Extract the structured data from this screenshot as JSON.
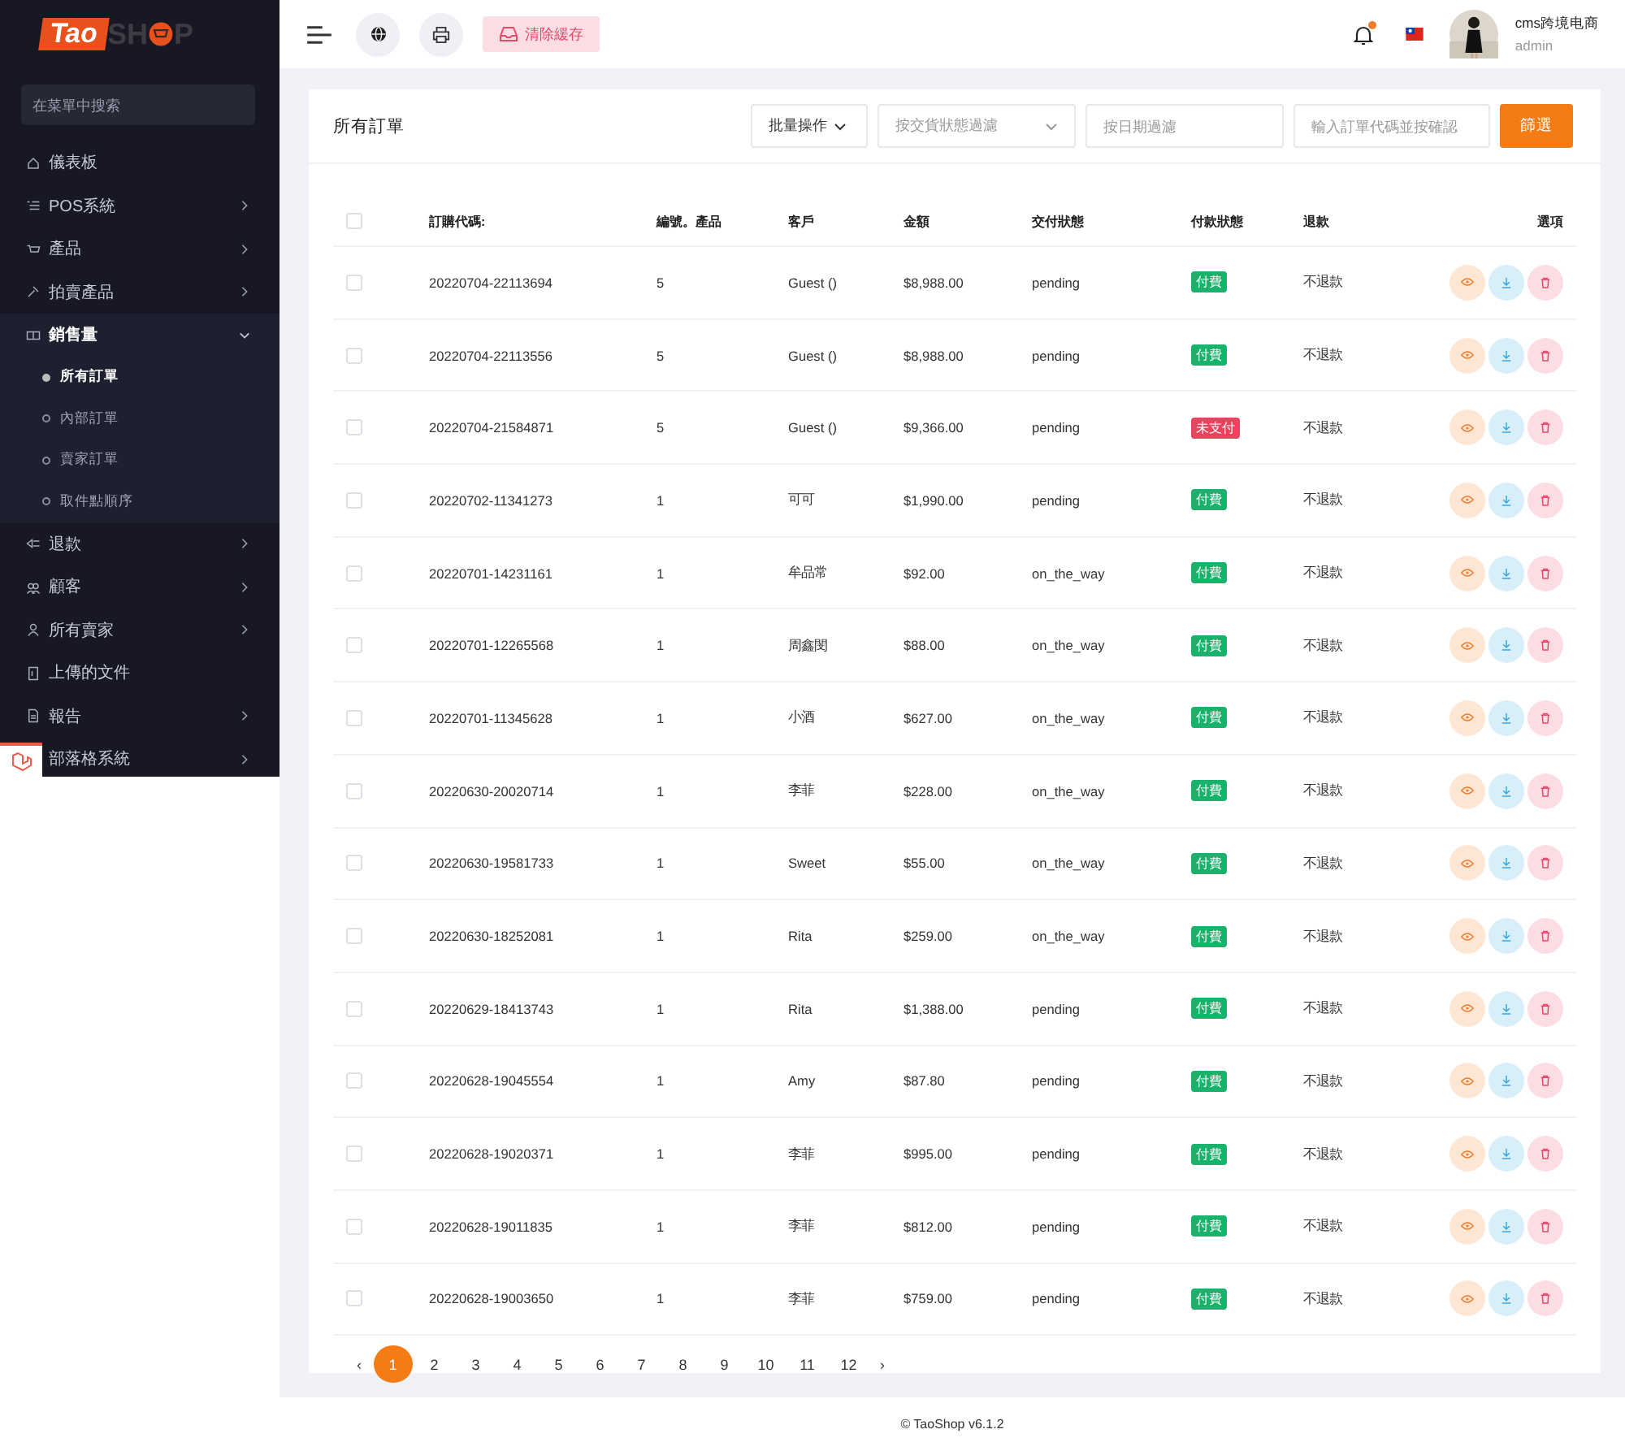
{
  "brand": {
    "prefix": "Tao",
    "word_start": "SH",
    "word_end": "P"
  },
  "sidebar": {
    "search": {
      "placeholder": "在菜單中搜索"
    },
    "items": [
      {
        "label": "儀表板",
        "has_arrow": false,
        "expanded": false
      },
      {
        "label": "POS系統",
        "has_arrow": true,
        "expanded": false
      },
      {
        "label": "產品",
        "has_arrow": true,
        "expanded": false
      },
      {
        "label": "拍賣產品",
        "has_arrow": true,
        "expanded": false
      },
      {
        "label": "銷售量",
        "has_arrow": true,
        "expanded": true,
        "children": [
          {
            "label": "所有訂單",
            "selected": true
          },
          {
            "label": "內部訂單",
            "selected": false
          },
          {
            "label": "賣家訂單",
            "selected": false
          },
          {
            "label": "取件點順序",
            "selected": false
          }
        ]
      },
      {
        "label": "退款",
        "has_arrow": true,
        "expanded": false
      },
      {
        "label": "顧客",
        "has_arrow": true,
        "expanded": false
      },
      {
        "label": "所有賣家",
        "has_arrow": true,
        "expanded": false
      },
      {
        "label": "上傳的文件",
        "has_arrow": false,
        "expanded": false
      },
      {
        "label": "報告",
        "has_arrow": true,
        "expanded": false
      },
      {
        "label": "部落格系統",
        "has_arrow": true,
        "expanded": false
      }
    ]
  },
  "topbar": {
    "clear_cache": "清除緩存",
    "notification": true,
    "user": {
      "name": "cms跨境电商",
      "role": "admin"
    }
  },
  "card": {
    "title": "所有訂單",
    "filters": {
      "bulk": "批量操作",
      "delivery_placeholder": "按交貨狀態過濾",
      "date_placeholder": "按日期過濾",
      "search_placeholder": "輸入訂單代碼並按確認",
      "button": "篩選"
    },
    "table": {
      "select_all_checked": false,
      "columns": [
        "訂購代碼:",
        "編號。產品",
        "客戶",
        "金額",
        "交付狀態",
        "付款狀態",
        "退款",
        "選項"
      ],
      "rows": [
        {
          "code": "20220704-22113694",
          "count": "5",
          "customer": "Guest ()",
          "amount": "$8,988.00",
          "delivery": "pending",
          "payment": "付費",
          "paid": true,
          "refund": "不退款",
          "checked": false
        },
        {
          "code": "20220704-22113556",
          "count": "5",
          "customer": "Guest ()",
          "amount": "$8,988.00",
          "delivery": "pending",
          "payment": "付費",
          "paid": true,
          "refund": "不退款",
          "checked": false
        },
        {
          "code": "20220704-21584871",
          "count": "5",
          "customer": "Guest ()",
          "amount": "$9,366.00",
          "delivery": "pending",
          "payment": "未支付",
          "paid": false,
          "refund": "不退款",
          "checked": false
        },
        {
          "code": "20220702-11341273",
          "count": "1",
          "customer": "可可",
          "amount": "$1,990.00",
          "delivery": "pending",
          "payment": "付費",
          "paid": true,
          "refund": "不退款",
          "checked": false
        },
        {
          "code": "20220701-14231161",
          "count": "1",
          "customer": "牟品常",
          "amount": "$92.00",
          "delivery": "on_the_way",
          "payment": "付費",
          "paid": true,
          "refund": "不退款",
          "checked": false
        },
        {
          "code": "20220701-12265568",
          "count": "1",
          "customer": "周鑫閔",
          "amount": "$88.00",
          "delivery": "on_the_way",
          "payment": "付費",
          "paid": true,
          "refund": "不退款",
          "checked": false
        },
        {
          "code": "20220701-11345628",
          "count": "1",
          "customer": "小酒",
          "amount": "$627.00",
          "delivery": "on_the_way",
          "payment": "付費",
          "paid": true,
          "refund": "不退款",
          "checked": false
        },
        {
          "code": "20220630-20020714",
          "count": "1",
          "customer": "李菲",
          "amount": "$228.00",
          "delivery": "on_the_way",
          "payment": "付費",
          "paid": true,
          "refund": "不退款",
          "checked": false
        },
        {
          "code": "20220630-19581733",
          "count": "1",
          "customer": "Sweet",
          "amount": "$55.00",
          "delivery": "on_the_way",
          "payment": "付費",
          "paid": true,
          "refund": "不退款",
          "checked": false
        },
        {
          "code": "20220630-18252081",
          "count": "1",
          "customer": "Rita",
          "amount": "$259.00",
          "delivery": "on_the_way",
          "payment": "付費",
          "paid": true,
          "refund": "不退款",
          "checked": false
        },
        {
          "code": "20220629-18413743",
          "count": "1",
          "customer": "Rita",
          "amount": "$1,388.00",
          "delivery": "pending",
          "payment": "付費",
          "paid": true,
          "refund": "不退款",
          "checked": false
        },
        {
          "code": "20220628-19045554",
          "count": "1",
          "customer": "Amy",
          "amount": "$87.80",
          "delivery": "pending",
          "payment": "付費",
          "paid": true,
          "refund": "不退款",
          "checked": false
        },
        {
          "code": "20220628-19020371",
          "count": "1",
          "customer": "李菲",
          "amount": "$995.00",
          "delivery": "pending",
          "payment": "付費",
          "paid": true,
          "refund": "不退款",
          "checked": false
        },
        {
          "code": "20220628-19011835",
          "count": "1",
          "customer": "李菲",
          "amount": "$812.00",
          "delivery": "pending",
          "payment": "付費",
          "paid": true,
          "refund": "不退款",
          "checked": false
        },
        {
          "code": "20220628-19003650",
          "count": "1",
          "customer": "李菲",
          "amount": "$759.00",
          "delivery": "pending",
          "payment": "付費",
          "paid": true,
          "refund": "不退款",
          "checked": false
        }
      ]
    },
    "pagination": {
      "prev": "‹",
      "next": "›",
      "pages": [
        {
          "label": "1",
          "selected": true
        },
        {
          "label": "2",
          "selected": false
        },
        {
          "label": "3",
          "selected": false
        },
        {
          "label": "4",
          "selected": false
        },
        {
          "label": "5",
          "selected": false
        },
        {
          "label": "6",
          "selected": false
        },
        {
          "label": "7",
          "selected": false
        },
        {
          "label": "8",
          "selected": false
        },
        {
          "label": "9",
          "selected": false
        },
        {
          "label": "10",
          "selected": false
        },
        {
          "label": "11",
          "selected": false
        },
        {
          "label": "12",
          "selected": false
        }
      ]
    }
  },
  "footer": "© TaoShop v6.1.2"
}
